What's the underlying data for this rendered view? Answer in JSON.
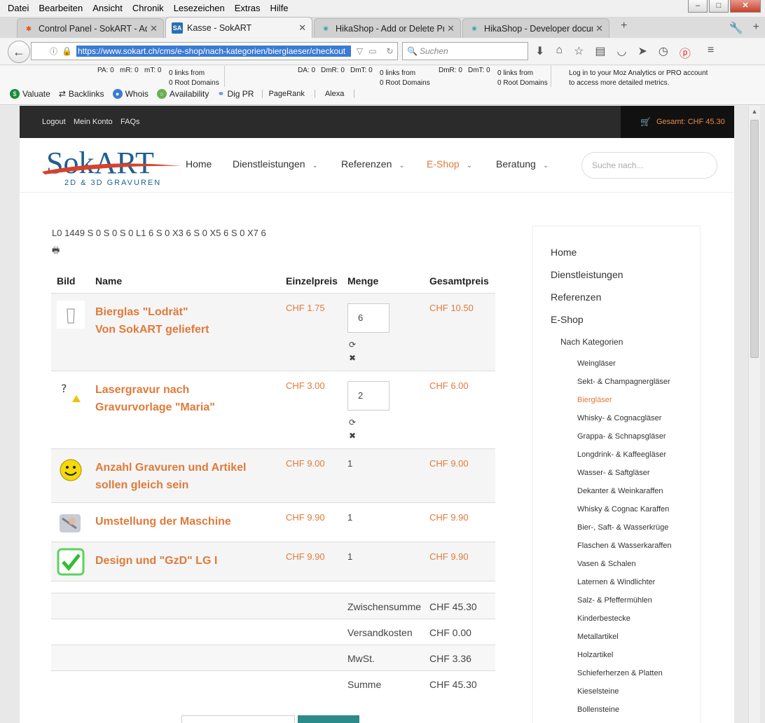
{
  "menubar": [
    "Datei",
    "Bearbeiten",
    "Ansicht",
    "Chronik",
    "Lesezeichen",
    "Extras",
    "Hilfe"
  ],
  "window_controls": {
    "minimize": "–",
    "maximize": "□",
    "close": "✕"
  },
  "tabs": [
    {
      "label": "Control Panel - SokART - Adm",
      "icon": "joomla-icon"
    },
    {
      "label": "Kasse - SokART",
      "icon": "sa-icon",
      "icon_text": "SA"
    },
    {
      "label": "HikaShop - Add or Delete Pro",
      "icon": "hikashop-icon"
    },
    {
      "label": "HikaShop - Developer docum",
      "icon": "hikashop-icon"
    }
  ],
  "url": "https://www.sokart.ch/cms/e-shop/nach-kategorien/bierglaeser/checkout",
  "search_placeholder": "Suchen",
  "moz": {
    "pa": "PA: 0",
    "mr": "mR: 0",
    "mt": "mT: 0",
    "links1": "0 links from",
    "root1": "0 Root Domains",
    "da": "DA: 0",
    "dmr": "DmR: 0",
    "dmt": "DmT: 0",
    "links2": "0 links from",
    "root2": "0 Root Domains",
    "dmr2": "DmR: 0",
    "dmt2": "DmT: 0",
    "links3": "0 links from",
    "root3": "0 Root Domains",
    "login1": "Log in to your Moz Analytics or PRO account",
    "login2": "to access more detailed metrics."
  },
  "toolbar": [
    "Valuate",
    "Backlinks",
    "Whois",
    "Availability",
    "Dig PR",
    "PageRank",
    "Alexa"
  ],
  "site": {
    "top_links": [
      "Logout",
      "Mein Konto",
      "FAQs"
    ],
    "cart_total": "Gesamt: CHF 45.30",
    "logo_main": "SokART",
    "logo_sub": "2D & 3D GRAVUREN",
    "nav": [
      {
        "label": "Home",
        "dropdown": false
      },
      {
        "label": "Dienstleistungen",
        "dropdown": true
      },
      {
        "label": "Referenzen",
        "dropdown": true
      },
      {
        "label": "E-Shop",
        "dropdown": true,
        "active": true
      },
      {
        "label": "Beratung",
        "dropdown": true
      }
    ],
    "search_placeholder": "Suche nach...",
    "steps_text": "L0 1449 S 0 S 0 S 0 L1 6 S 0 X3 6 S 0 X5 6 S 0 X7 6"
  },
  "cart": {
    "headers": [
      "Bild",
      "Name",
      "Einzelpreis",
      "Menge",
      "Gesamtpreis"
    ],
    "rows": [
      {
        "line1": "Bierglas \"Lodrät\"",
        "line2": "Von SokART geliefert",
        "price": "CHF 1.75",
        "qty": "6",
        "editable": true,
        "total": "CHF 10.50",
        "img": "beer-glass-image"
      },
      {
        "line1": "Lasergravur nach",
        "line2": "Gravurvorlage \"Maria\"",
        "price": "CHF 3.00",
        "qty": "2",
        "editable": true,
        "total": "CHF 6.00",
        "img": "engraving-template-image"
      },
      {
        "line1": "Anzahl Gravuren und Artikel",
        "line2": "sollen gleich sein",
        "price": "CHF 9.00",
        "qty": "1",
        "editable": false,
        "total": "CHF 9.00",
        "img": "smiley-image"
      },
      {
        "line1": "Umstellung der Maschine",
        "line2": "",
        "price": "CHF 9.90",
        "qty": "1",
        "editable": false,
        "total": "CHF 9.90",
        "img": "machine-image"
      },
      {
        "line1": "Design und \"GzD\" LG I",
        "line2": "",
        "price": "CHF 9.90",
        "qty": "1",
        "editable": false,
        "total": "CHF 9.90",
        "img": "checkmark-image"
      }
    ],
    "summary": [
      {
        "label": "Zwischensumme",
        "value": "CHF 45.30"
      },
      {
        "label": "Versandkosten",
        "value": "CHF 0.00"
      },
      {
        "label": "MwSt.",
        "value": "CHF 3.36"
      },
      {
        "label": "Summe",
        "value": "CHF 45.30"
      }
    ]
  },
  "sidebar": {
    "level1": [
      "Home",
      "Dienstleistungen",
      "Referenzen",
      "E-Shop"
    ],
    "level2": "Nach Kategorien",
    "level3": [
      "Weingläser",
      "Sekt- & Champagnergläser",
      "Biergläser",
      "Whisky- & Cognacgläser",
      "Grappa- & Schnapsgläser",
      "Longdrink- & Kaffeegläser",
      "Wasser- & Saftgläser",
      "Dekanter & Weinkaraffen",
      "Whisky & Cognac Karaffen",
      "Bier-, Saft- & Wasserkrüge",
      "Flaschen & Wasserkaraffen",
      "Vasen & Schalen",
      "Laternen & Windlichter",
      "Salz- & Pfeffermühlen",
      "Kinderbestecke",
      "Metallartikel",
      "Holzartikel",
      "Schieferherzen & Platten",
      "Kieselsteine",
      "Bollensteine"
    ],
    "active": "Biergläser"
  },
  "colors": {
    "accent": "#e07a3a",
    "topbar": "#2b2b2b",
    "logo_blue": "#1f5f8f",
    "logo_swoosh": "#d9412a"
  }
}
